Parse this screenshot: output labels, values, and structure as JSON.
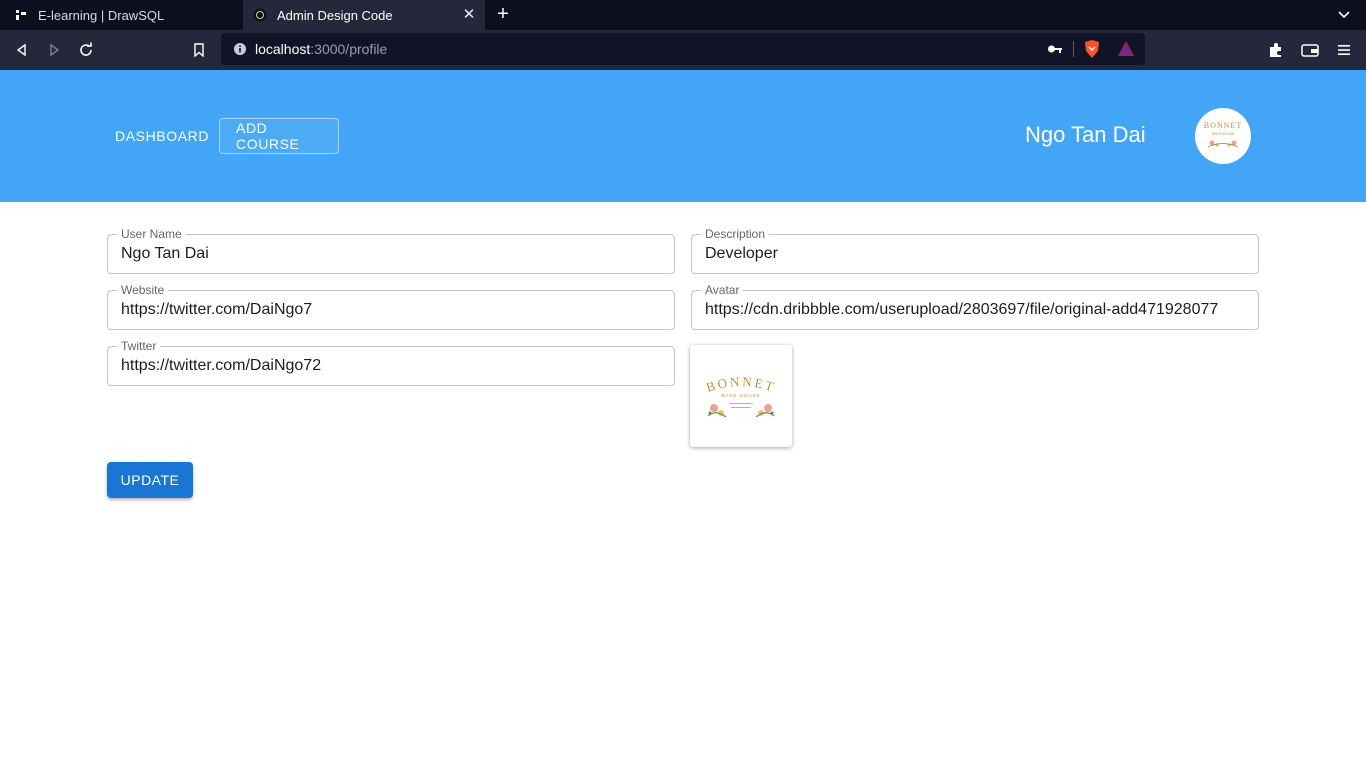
{
  "browser": {
    "tabs": [
      {
        "title": "E-learning | DrawSQL",
        "icon": "drawsql-icon",
        "active": false
      },
      {
        "title": "Admin Design Code",
        "icon": "site-icon",
        "active": true
      }
    ],
    "url_host": "localhost",
    "url_path": ":3000/profile"
  },
  "header": {
    "nav": [
      {
        "label": "DASHBOARD"
      },
      {
        "label": "ADD COURSE"
      }
    ],
    "user_name": "Ngo Tan Dai",
    "avatar_icon": "bonnet-bake-house-logo"
  },
  "form": {
    "user_name": {
      "label": "User Name",
      "value": "Ngo Tan Dai"
    },
    "website": {
      "label": "Website",
      "value": "https://twitter.com/DaiNgo7"
    },
    "twitter": {
      "label": "Twitter",
      "value": "https://twitter.com/DaiNgo72"
    },
    "description": {
      "label": "Description",
      "value": "Developer"
    },
    "avatar": {
      "label": "Avatar",
      "value": "https://cdn.dribbble.com/userupload/2803697/file/original-add471928077"
    },
    "update_label": "UPDATE"
  },
  "logo": {
    "top": "BONNET",
    "sub": "BAKE HOUSE"
  },
  "colors": {
    "header_bg": "#42a5f5",
    "primary": "#1976d2",
    "tabbar_bg": "#0d0f1e",
    "toolbar_bg": "#25283a"
  }
}
